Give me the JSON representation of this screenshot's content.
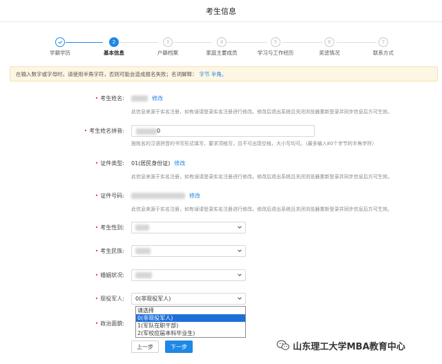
{
  "page": {
    "title": "考生信息"
  },
  "steps": [
    {
      "num": "",
      "label": "学籍学历",
      "state": "done"
    },
    {
      "num": "2",
      "label": "基本信息",
      "state": "active"
    },
    {
      "num": "3",
      "label": "户籍档案",
      "state": "todo"
    },
    {
      "num": "4",
      "label": "家庭主要成员",
      "state": "todo"
    },
    {
      "num": "5",
      "label": "学习与工作经历",
      "state": "todo"
    },
    {
      "num": "6",
      "label": "奖惩情况",
      "state": "todo"
    },
    {
      "num": "7",
      "label": "联系方式",
      "state": "todo"
    }
  ],
  "notice": {
    "text": "在输入数字或字母时，请使用半角字符，否则可能会造成报名失败；名词解释：",
    "link": "字节 半角。"
  },
  "fields": {
    "name": {
      "label": "考生姓名:",
      "action": "修改",
      "help": "此信息来源于实名注册，如有误请登录实名注册进行修改。修改后退出系统且关闭浏览器重新登录并同步信息后方可生效。"
    },
    "pinyin": {
      "label": "考生姓名拼音:",
      "value_tail": "0",
      "help": "按姓名的汉语拼音的书写形式填写，要求顶格写，且不可出现空格，大小写均可。（最多输入80个字节的半角字符）"
    },
    "id_type": {
      "label": "证件类型:",
      "value": "01(居民身份证)",
      "action": "修改",
      "help": "此信息来源于实名注册，如有误请登录实名注册进行修改。修改后退出系统且关闭浏览器重新登录并同步信息后方可生效。"
    },
    "id_number": {
      "label": "证件号码:",
      "action": "修改",
      "help": "此信息来源于实名注册，如有误请登录实名注册进行修改。修改后退出系统且关闭浏览器重新登录并同步信息后方可生效。"
    },
    "gender": {
      "label": "考生性别:",
      "value": ""
    },
    "ethnicity": {
      "label": "考生民族:",
      "value": ""
    },
    "marital": {
      "label": "婚姻状况:",
      "value": ""
    },
    "military": {
      "label": "现役军人:",
      "value": "0(非现役军人)",
      "options": [
        "请选择",
        "0(非现役军人)",
        "1(军队在职干部)",
        "2(军校应届本科毕业生)"
      ],
      "selected_index": 1
    },
    "political": {
      "label": "政治面貌:"
    }
  },
  "buttons": {
    "prev": "上一步",
    "next": "下一步"
  },
  "watermark": {
    "text": "山东理工大学MBA教育中心"
  },
  "colors": {
    "primary": "#1e88e5",
    "required": "#e53935",
    "notice_bg": "#fdf6e3"
  }
}
